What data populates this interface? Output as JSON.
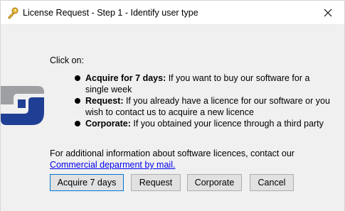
{
  "window": {
    "title": "License Request - Step 1 - Identify user type",
    "icons": {
      "title": "key-icon",
      "close": "close-icon",
      "logo": "company-logo-icon"
    }
  },
  "content": {
    "intro": "Click on:",
    "options": [
      {
        "label": "Acquire for 7 days:",
        "text": " If you want to buy our software for a single week"
      },
      {
        "label": "Request:",
        "text": " If you already have a licence for our software or you wish to contact us to acquire a new licence"
      },
      {
        "label": "Corporate:",
        "text": " If you obtained your licence through a third party"
      }
    ],
    "info_text": "For additional information about software licences, contact our",
    "info_link": "Commercial deparment by mail."
  },
  "buttons": {
    "acquire": "Acquire 7 days",
    "request": "Request",
    "corporate": "Corporate",
    "cancel": "Cancel"
  },
  "colors": {
    "logo_gray": "#9d9fa3",
    "logo_blue": "#1f3f94",
    "link": "#0000ee"
  }
}
